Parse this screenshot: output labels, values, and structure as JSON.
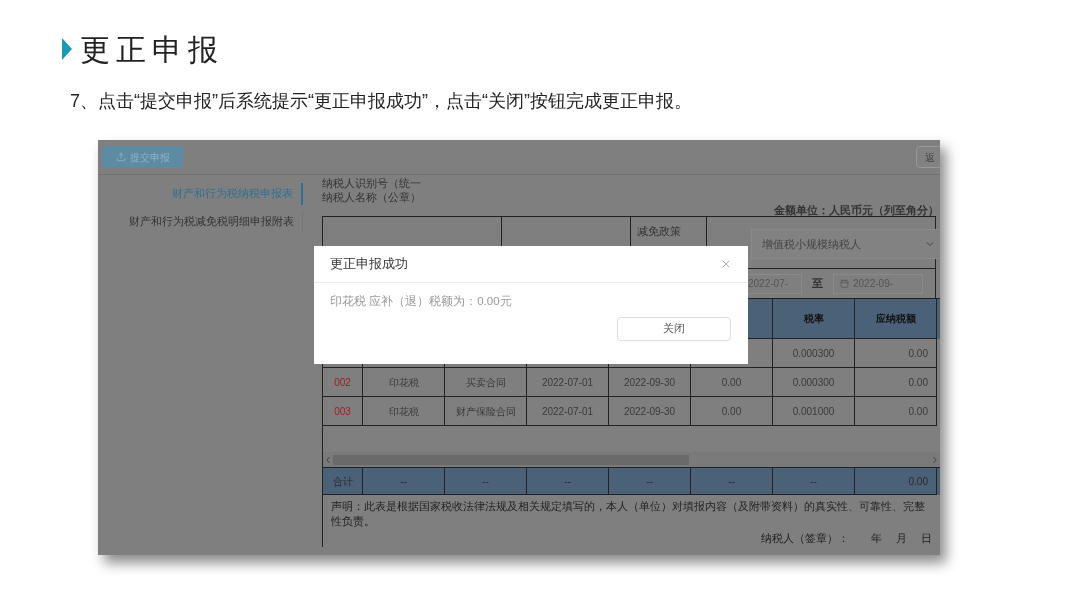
{
  "slide": {
    "title": "更正申报",
    "instruction": "7、点击“提交申报”后系统提示“更正申报成功”，点击“关闭”按钮完成更正申报。"
  },
  "toolbar": {
    "submit_button": "提交申报",
    "back_button": "返"
  },
  "sidebar": {
    "items": [
      {
        "label": "财产和行为税纳税申报表",
        "selected": true
      },
      {
        "label": "财产和行为税减免税明细申报附表",
        "selected": false
      }
    ]
  },
  "form": {
    "taxpayer_id_label": "纳税人识别号（统一",
    "taxpayer_name_label": "纳税人名称（公章）",
    "currency_note": "金额单位：人民币元（列至角分）",
    "policy_label": "减免政策",
    "policy_select": "增值税小规模纳税人",
    "period_start": "2022-07-",
    "period_separator": "至",
    "period_end": "2022-09-"
  },
  "table": {
    "visible_headers": [
      "税率",
      "应纳税额"
    ],
    "rows": [
      {
        "cells": [
          "",
          "",
          "",
          "",
          "",
          "",
          "0.000300",
          "0.00"
        ]
      },
      {
        "cells": [
          "002",
          "印花税",
          "买卖合同",
          "2022-07-01",
          "2022-09-30",
          "0.00",
          "0.000300",
          "0.00"
        ]
      },
      {
        "cells": [
          "003",
          "印花税",
          "财产保险合同",
          "2022-07-01",
          "2022-09-30",
          "0.00",
          "0.001000",
          "0.00"
        ]
      }
    ],
    "total_row": {
      "label": "合计",
      "cells": [
        "--",
        "--",
        "--",
        "--",
        "--",
        "--",
        "0.00"
      ]
    }
  },
  "declaration": "声明：此表是根据国家税收法律法规及相关规定填写的，本人（单位）对填报内容（及附带资料）的真实性、可靠性、完整性负责。",
  "signature": {
    "label": "纳税人（签章）：",
    "year": "年",
    "month": "月",
    "day": "日"
  },
  "dialog": {
    "title": "更正申报成功",
    "message": "印花税 应补（退）税额为：0.00元",
    "close_button": "关闭"
  }
}
